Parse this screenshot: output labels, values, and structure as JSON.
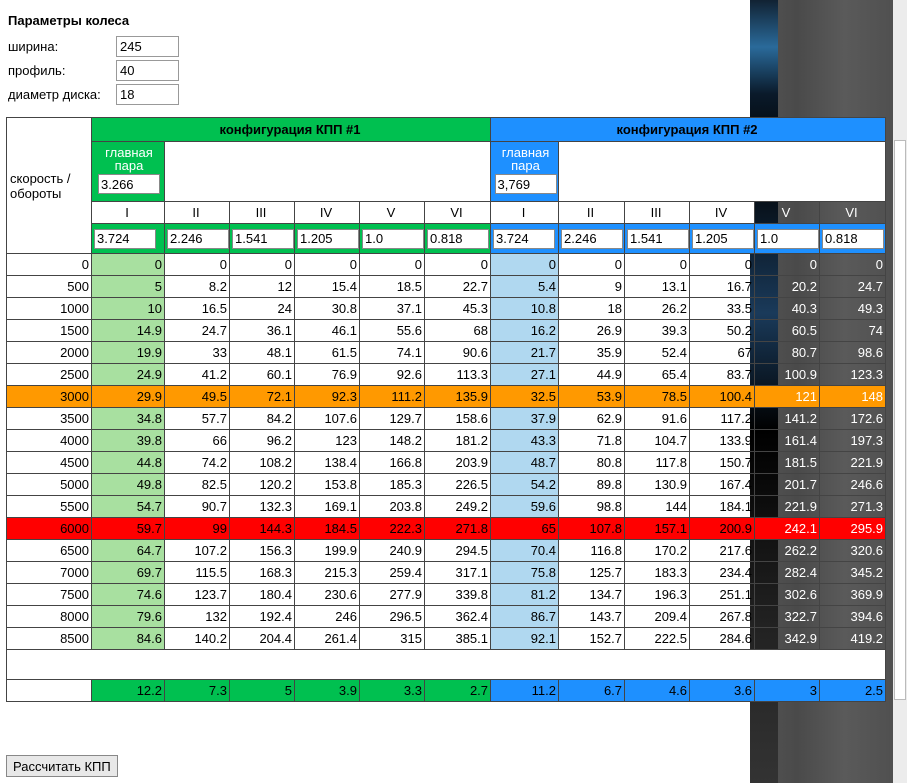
{
  "params": {
    "title": "Параметры колеса",
    "fields": [
      {
        "label": "ширина:",
        "value": "245"
      },
      {
        "label": "профиль:",
        "value": "40"
      },
      {
        "label": "диаметр диска:",
        "value": "18"
      }
    ]
  },
  "table": {
    "side_header": "скорость / обороты",
    "config1_title": "конфигурация КПП #1",
    "config2_title": "конфигурация КПП #2",
    "main_pair_label": "главная пара",
    "main_pair1": "3.266",
    "main_pair2": "3,769",
    "gears": [
      "I",
      "II",
      "III",
      "IV",
      "V",
      "VI"
    ],
    "ratios1": [
      "3.724",
      "2.246",
      "1.541",
      "1.205",
      "1.0",
      "0.818"
    ],
    "ratios2": [
      "3.724",
      "2.246",
      "1.541",
      "1.205",
      "1.0",
      "0.818"
    ],
    "rows": [
      {
        "rpm": "0",
        "c1": [
          "0",
          "0",
          "0",
          "0",
          "0",
          "0"
        ],
        "c2": [
          "0",
          "0",
          "0",
          "0",
          "0",
          "0"
        ]
      },
      {
        "rpm": "500",
        "c1": [
          "5",
          "8.2",
          "12",
          "15.4",
          "18.5",
          "22.7"
        ],
        "c2": [
          "5.4",
          "9",
          "13.1",
          "16.7",
          "20.2",
          "24.7"
        ]
      },
      {
        "rpm": "1000",
        "c1": [
          "10",
          "16.5",
          "24",
          "30.8",
          "37.1",
          "45.3"
        ],
        "c2": [
          "10.8",
          "18",
          "26.2",
          "33.5",
          "40.3",
          "49.3"
        ]
      },
      {
        "rpm": "1500",
        "c1": [
          "14.9",
          "24.7",
          "36.1",
          "46.1",
          "55.6",
          "68"
        ],
        "c2": [
          "16.2",
          "26.9",
          "39.3",
          "50.2",
          "60.5",
          "74"
        ]
      },
      {
        "rpm": "2000",
        "c1": [
          "19.9",
          "33",
          "48.1",
          "61.5",
          "74.1",
          "90.6"
        ],
        "c2": [
          "21.7",
          "35.9",
          "52.4",
          "67",
          "80.7",
          "98.6"
        ]
      },
      {
        "rpm": "2500",
        "c1": [
          "24.9",
          "41.2",
          "60.1",
          "76.9",
          "92.6",
          "113.3"
        ],
        "c2": [
          "27.1",
          "44.9",
          "65.4",
          "83.7",
          "100.9",
          "123.3"
        ]
      },
      {
        "rpm": "3000",
        "c1": [
          "29.9",
          "49.5",
          "72.1",
          "92.3",
          "111.2",
          "135.9"
        ],
        "c2": [
          "32.5",
          "53.9",
          "78.5",
          "100.4",
          "121",
          "148"
        ],
        "hl": "orange"
      },
      {
        "rpm": "3500",
        "c1": [
          "34.8",
          "57.7",
          "84.2",
          "107.6",
          "129.7",
          "158.6"
        ],
        "c2": [
          "37.9",
          "62.9",
          "91.6",
          "117.2",
          "141.2",
          "172.6"
        ]
      },
      {
        "rpm": "4000",
        "c1": [
          "39.8",
          "66",
          "96.2",
          "123",
          "148.2",
          "181.2"
        ],
        "c2": [
          "43.3",
          "71.8",
          "104.7",
          "133.9",
          "161.4",
          "197.3"
        ]
      },
      {
        "rpm": "4500",
        "c1": [
          "44.8",
          "74.2",
          "108.2",
          "138.4",
          "166.8",
          "203.9"
        ],
        "c2": [
          "48.7",
          "80.8",
          "117.8",
          "150.7",
          "181.5",
          "221.9"
        ]
      },
      {
        "rpm": "5000",
        "c1": [
          "49.8",
          "82.5",
          "120.2",
          "153.8",
          "185.3",
          "226.5"
        ],
        "c2": [
          "54.2",
          "89.8",
          "130.9",
          "167.4",
          "201.7",
          "246.6"
        ]
      },
      {
        "rpm": "5500",
        "c1": [
          "54.7",
          "90.7",
          "132.3",
          "169.1",
          "203.8",
          "249.2"
        ],
        "c2": [
          "59.6",
          "98.8",
          "144",
          "184.1",
          "221.9",
          "271.3"
        ]
      },
      {
        "rpm": "6000",
        "c1": [
          "59.7",
          "99",
          "144.3",
          "184.5",
          "222.3",
          "271.8"
        ],
        "c2": [
          "65",
          "107.8",
          "157.1",
          "200.9",
          "242.1",
          "295.9"
        ],
        "hl": "red"
      },
      {
        "rpm": "6500",
        "c1": [
          "64.7",
          "107.2",
          "156.3",
          "199.9",
          "240.9",
          "294.5"
        ],
        "c2": [
          "70.4",
          "116.8",
          "170.2",
          "217.6",
          "262.2",
          "320.6"
        ]
      },
      {
        "rpm": "7000",
        "c1": [
          "69.7",
          "115.5",
          "168.3",
          "215.3",
          "259.4",
          "317.1"
        ],
        "c2": [
          "75.8",
          "125.7",
          "183.3",
          "234.4",
          "282.4",
          "345.2"
        ]
      },
      {
        "rpm": "7500",
        "c1": [
          "74.6",
          "123.7",
          "180.4",
          "230.6",
          "277.9",
          "339.8"
        ],
        "c2": [
          "81.2",
          "134.7",
          "196.3",
          "251.1",
          "302.6",
          "369.9"
        ]
      },
      {
        "rpm": "8000",
        "c1": [
          "79.6",
          "132",
          "192.4",
          "246",
          "296.5",
          "362.4"
        ],
        "c2": [
          "86.7",
          "143.7",
          "209.4",
          "267.8",
          "322.7",
          "394.6"
        ]
      },
      {
        "rpm": "8500",
        "c1": [
          "84.6",
          "140.2",
          "204.4",
          "261.4",
          "315",
          "385.1"
        ],
        "c2": [
          "92.1",
          "152.7",
          "222.5",
          "284.6",
          "342.9",
          "419.2"
        ]
      }
    ],
    "diff1": [
      "12.2",
      "7.3",
      "5",
      "3.9",
      "3.3",
      "2.7"
    ],
    "diff2": [
      "11.2",
      "6.7",
      "4.6",
      "3.6",
      "3",
      "2.5"
    ]
  },
  "button_label": "Рассчитать КПП"
}
